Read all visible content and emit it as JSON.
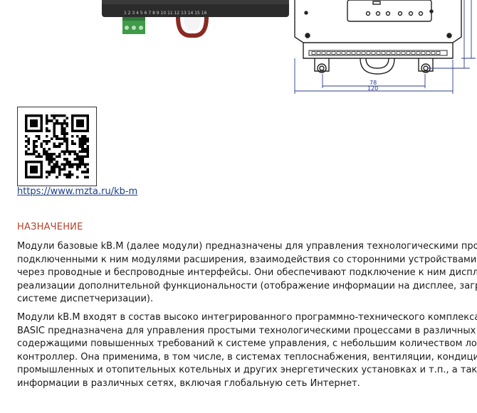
{
  "drawing": {
    "dims": [
      "78",
      "120"
    ],
    "terminal_numbers": "1 2 3   4 5 6 7 8 9 10 11 12 13 14 15 16"
  },
  "qr_link": "https://www.mzta.ru/kb-m",
  "section": {
    "heading": "НАЗНАЧЕНИЕ",
    "paragraph1": [
      "Модули базовые kB.M (далее модули) предназначены для управления технологическими проце",
      "подключенными к ним модулями расширения, взаимодействия со сторонними устройствами и с",
      "через проводные и беспроводные интерфейсы. Они обеспечивают подключение к ним дисплей",
      "реализации дополнительной функциональности (отображение информации на дисплее, загруз",
      "системе диспетчеризации)."
    ],
    "paragraph2": [
      "Модули kB.M входят в состав высоко интегрированного программно-технического комплекса КС",
      "BASIC предназначена для управления простыми технологическими процессами в различных отр",
      "содержащими повышенных требований к системе управления, с небольшим количеством локал",
      "контроллер. Она применима, в том числе, в системах теплоснабжения, вентиляции, кондицион",
      "промышленных и отопительных котельных и других энергетических установках и т.п., а также",
      "информации в различных сетях, включая глобальную сеть Интернет."
    ]
  }
}
